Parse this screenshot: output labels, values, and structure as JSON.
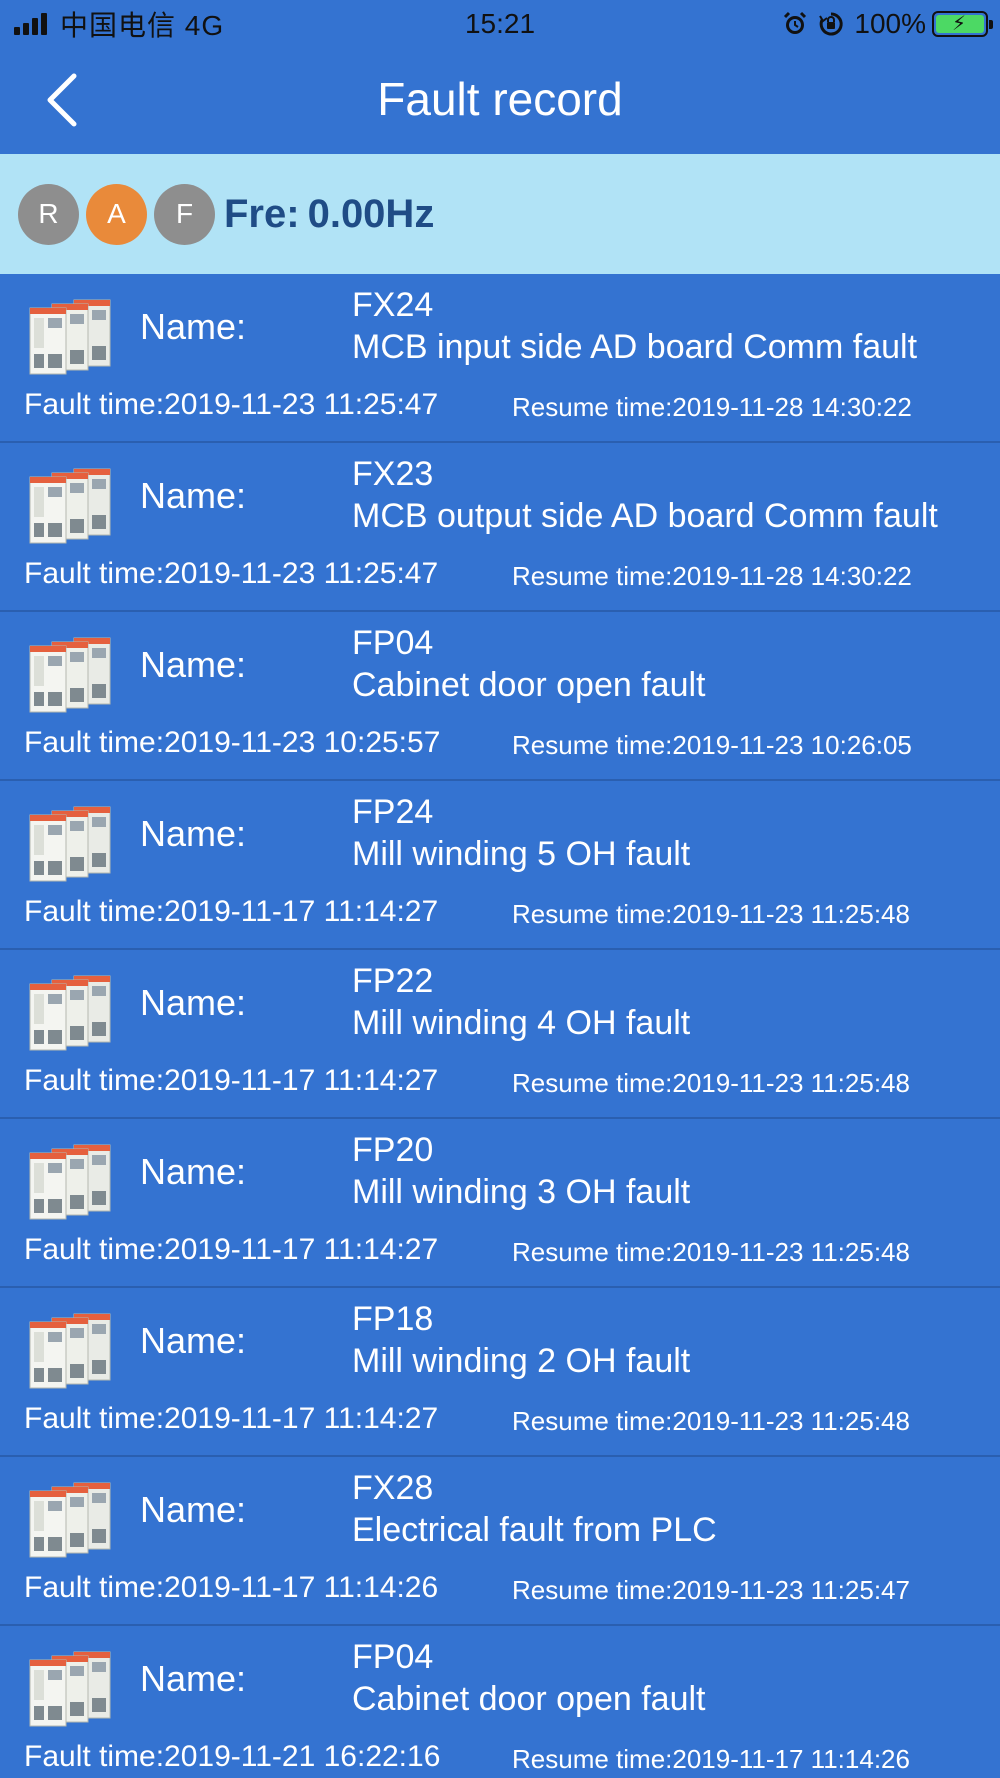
{
  "status_bar": {
    "carrier": "中国电信 4G",
    "time": "15:21",
    "battery_percent": "100%",
    "icons": [
      "signal-icon",
      "alarm-icon",
      "rotation-lock-icon",
      "battery-charging-icon"
    ]
  },
  "nav": {
    "back_icon": "chevron-left-icon",
    "title": "Fault record"
  },
  "status": {
    "indicators": [
      {
        "label": "R",
        "color": "#8e8e8e"
      },
      {
        "label": "A",
        "color": "#e98a3a"
      },
      {
        "label": "F",
        "color": "#8e8e8e"
      }
    ],
    "fre_label": "Fre:",
    "fre_value": "0.00Hz"
  },
  "labels": {
    "name": "Name:",
    "fault_time": "Fault time:",
    "resume_time": "Resume time:"
  },
  "faults": [
    {
      "code": "FX24",
      "desc": "MCB input side AD board Comm fault",
      "fault_time": "2019-11-23 11:25:47",
      "resume_time": "2019-11-28 14:30:22"
    },
    {
      "code": "FX23",
      "desc": "MCB output side AD board Comm fault",
      "fault_time": "2019-11-23 11:25:47",
      "resume_time": "2019-11-28 14:30:22"
    },
    {
      "code": "FP04",
      "desc": "Cabinet door open fault",
      "fault_time": "2019-11-23 10:25:57",
      "resume_time": "2019-11-23 10:26:05"
    },
    {
      "code": "FP24",
      "desc": "Mill winding 5 OH fault",
      "fault_time": "2019-11-17 11:14:27",
      "resume_time": "2019-11-23 11:25:48"
    },
    {
      "code": "FP22",
      "desc": "Mill winding 4 OH fault",
      "fault_time": "2019-11-17 11:14:27",
      "resume_time": "2019-11-23 11:25:48"
    },
    {
      "code": "FP20",
      "desc": "Mill winding 3 OH fault",
      "fault_time": "2019-11-17 11:14:27",
      "resume_time": "2019-11-23 11:25:48"
    },
    {
      "code": "FP18",
      "desc": "Mill winding 2 OH fault",
      "fault_time": "2019-11-17 11:14:27",
      "resume_time": "2019-11-23 11:25:48"
    },
    {
      "code": "FX28",
      "desc": "Electrical fault from PLC",
      "fault_time": "2019-11-17 11:14:26",
      "resume_time": "2019-11-23 11:25:47"
    },
    {
      "code": "FP04",
      "desc": "Cabinet door open fault",
      "fault_time": "2019-11-21 16:22:16",
      "resume_time": "2019-11-17 11:14:26"
    }
  ],
  "thumbnail_icon": "inverter-cabinet-icon"
}
